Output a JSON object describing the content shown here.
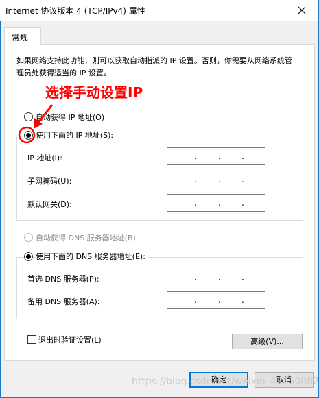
{
  "window": {
    "title": "Internet 协议版本 4 (TCP/IPv4) 属性"
  },
  "tabs": [
    {
      "label": "常规"
    }
  ],
  "description": "如果网络支持此功能，则可以获取自动指派的 IP 设置。否则，你需要从网络系统管理员处获得适当的 IP 设置。",
  "annotation": "选择手动设置IP",
  "ip_section": {
    "auto_label": "自动获得 IP 地址(O)",
    "manual_label": "使用下面的 IP 地址(S):",
    "selected": "manual",
    "fields": [
      {
        "label": "IP 地址(I):",
        "value": ". . ."
      },
      {
        "label": "子网掩码(U):",
        "value": ". . ."
      },
      {
        "label": "默认网关(D):",
        "value": ". . ."
      }
    ]
  },
  "dns_section": {
    "auto_label": "自动获得 DNS 服务器地址(B)",
    "manual_label": "使用下面的 DNS 服务器地址(E):",
    "selected": "manual",
    "fields": [
      {
        "label": "首选 DNS 服务器(P):",
        "value": ". . ."
      },
      {
        "label": "备用 DNS 服务器(A):",
        "value": ". . ."
      }
    ]
  },
  "validate_on_exit": {
    "label": "退出时验证设置(L)",
    "checked": false
  },
  "advanced_button": "高级(V)...",
  "ok_button": "确定",
  "cancel_button": "取消",
  "watermark": "https://blog.csdn.net/weixin_42350082",
  "colors": {
    "annotation": "#ff0000",
    "window_border": "#1979ca",
    "primary_button_border": "#0078d7"
  }
}
